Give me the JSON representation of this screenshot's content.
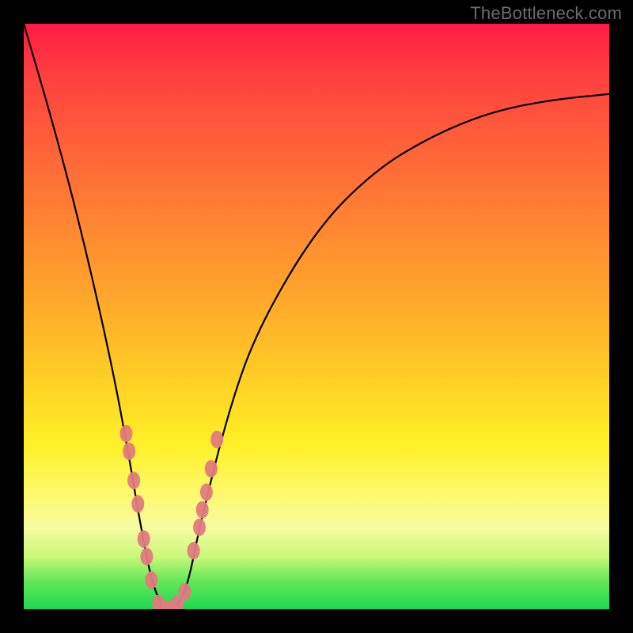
{
  "watermark": "TheBottleneck.com",
  "chart_data": {
    "type": "line",
    "title": "",
    "xlabel": "",
    "ylabel": "",
    "xlim": [
      0,
      1
    ],
    "ylim": [
      0,
      1
    ],
    "series": [
      {
        "name": "bottleneck-curve",
        "x": [
          0.0,
          0.05,
          0.1,
          0.15,
          0.18,
          0.2,
          0.22,
          0.24,
          0.26,
          0.28,
          0.3,
          0.35,
          0.4,
          0.5,
          0.6,
          0.7,
          0.8,
          0.9,
          1.0
        ],
        "y": [
          1.0,
          0.83,
          0.64,
          0.42,
          0.26,
          0.14,
          0.04,
          0.0,
          0.0,
          0.04,
          0.14,
          0.34,
          0.48,
          0.65,
          0.75,
          0.81,
          0.85,
          0.87,
          0.88
        ]
      }
    ],
    "markers": {
      "name": "highlight-points",
      "color": "#e17a80",
      "points": [
        {
          "x": 0.175,
          "y": 0.3
        },
        {
          "x": 0.18,
          "y": 0.27
        },
        {
          "x": 0.188,
          "y": 0.22
        },
        {
          "x": 0.195,
          "y": 0.18
        },
        {
          "x": 0.205,
          "y": 0.12
        },
        {
          "x": 0.21,
          "y": 0.09
        },
        {
          "x": 0.218,
          "y": 0.05
        },
        {
          "x": 0.23,
          "y": 0.01
        },
        {
          "x": 0.24,
          "y": 0.0
        },
        {
          "x": 0.252,
          "y": 0.0
        },
        {
          "x": 0.263,
          "y": 0.01
        },
        {
          "x": 0.275,
          "y": 0.03
        },
        {
          "x": 0.29,
          "y": 0.1
        },
        {
          "x": 0.3,
          "y": 0.14
        },
        {
          "x": 0.305,
          "y": 0.17
        },
        {
          "x": 0.312,
          "y": 0.2
        },
        {
          "x": 0.32,
          "y": 0.24
        },
        {
          "x": 0.33,
          "y": 0.29
        }
      ]
    }
  }
}
